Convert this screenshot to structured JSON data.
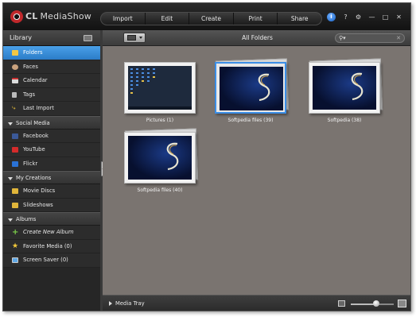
{
  "app": {
    "logo_text": "CL",
    "title": "MediaShow"
  },
  "nav": [
    "Import",
    "Edit",
    "Create",
    "Print",
    "Share"
  ],
  "window_controls": {
    "info": "i",
    "help": "?",
    "settings": "⚙",
    "minimize": "—",
    "maximize": "□",
    "close": "✕"
  },
  "sidebar": {
    "library_title": "Library",
    "library_items": [
      {
        "label": "Folders",
        "icon": "folder-icon",
        "selected": true
      },
      {
        "label": "Faces",
        "icon": "faces-icon"
      },
      {
        "label": "Calendar",
        "icon": "calendar-icon"
      },
      {
        "label": "Tags",
        "icon": "tag-icon"
      },
      {
        "label": "Last Import",
        "icon": "import-icon"
      }
    ],
    "social_title": "Social Media",
    "social_items": [
      {
        "label": "Facebook",
        "icon": "facebook-icon"
      },
      {
        "label": "YouTube",
        "icon": "youtube-icon"
      },
      {
        "label": "Flickr",
        "icon": "flickr-icon"
      }
    ],
    "creations_title": "My Creations",
    "creations_items": [
      {
        "label": "Movie Discs",
        "icon": "disc-icon"
      },
      {
        "label": "Slideshows",
        "icon": "slideshow-icon"
      }
    ],
    "albums_title": "Albums",
    "albums_items": [
      {
        "label": "Create New Album",
        "icon": "plus-icon"
      },
      {
        "label": "Favorite Media (0)",
        "icon": "star-icon"
      },
      {
        "label": "Screen Saver (0)",
        "icon": "monitor-icon"
      }
    ]
  },
  "main": {
    "title": "All Folders",
    "thumbnails": [
      {
        "caption": "Pictures (1)",
        "kind": "desktop",
        "selected": false
      },
      {
        "caption": "Softpedia files (39)",
        "kind": "swirl",
        "selected": true
      },
      {
        "caption": "Softpedia (38)",
        "kind": "swirl",
        "selected": false
      },
      {
        "caption": "Softpedia files (40)",
        "kind": "swirl",
        "selected": false
      }
    ]
  },
  "bottom": {
    "tray_label": "Media Tray",
    "zoom_level": 0.6
  },
  "colors": {
    "accent": "#3b8ee6",
    "background": "#7a7470",
    "sidebar": "#2c2c2c"
  }
}
